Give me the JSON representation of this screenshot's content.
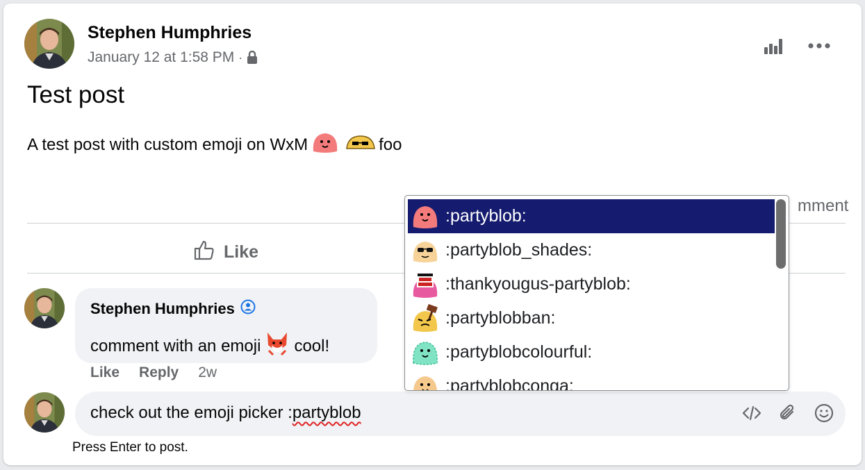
{
  "post": {
    "author": "Stephen Humphries",
    "timestamp": "January 12 at 1:58 PM",
    "separator": "·",
    "privacy_icon": "lock-icon",
    "title": "Test post",
    "body_text": "A test post with custom emoji on WxM",
    "body_suffix": "foo",
    "comment_link_partial": "mment",
    "insights_icon": "bar-chart-icon",
    "more_icon": "more-dots-icon"
  },
  "actions": {
    "like_label": "Like"
  },
  "comment": {
    "author": "Stephen Humphries",
    "text_before": "comment with an emoji",
    "text_after": "cool!",
    "like": "Like",
    "reply": "Reply",
    "age": "2w"
  },
  "composer": {
    "text_prefix": "check out the emoji picker :",
    "text_misspelled": "partyblob",
    "hint": "Press Enter to post.",
    "icons": [
      "code-icon",
      "paperclip-icon",
      "smiley-icon"
    ]
  },
  "emoji_picker": {
    "items": [
      {
        "label": ":partyblob:",
        "selected": true
      },
      {
        "label": ":partyblob_shades:",
        "selected": false
      },
      {
        "label": ":thankyougus-partyblob:",
        "selected": false
      },
      {
        "label": ":partyblobban:",
        "selected": false
      },
      {
        "label": ":partyblobcolourful:",
        "selected": false
      },
      {
        "label": ":partyblobconga:",
        "selected": false
      }
    ]
  },
  "colors": {
    "accent": "#151b6e",
    "verified": "#1b74e4",
    "muted": "#65676b"
  }
}
